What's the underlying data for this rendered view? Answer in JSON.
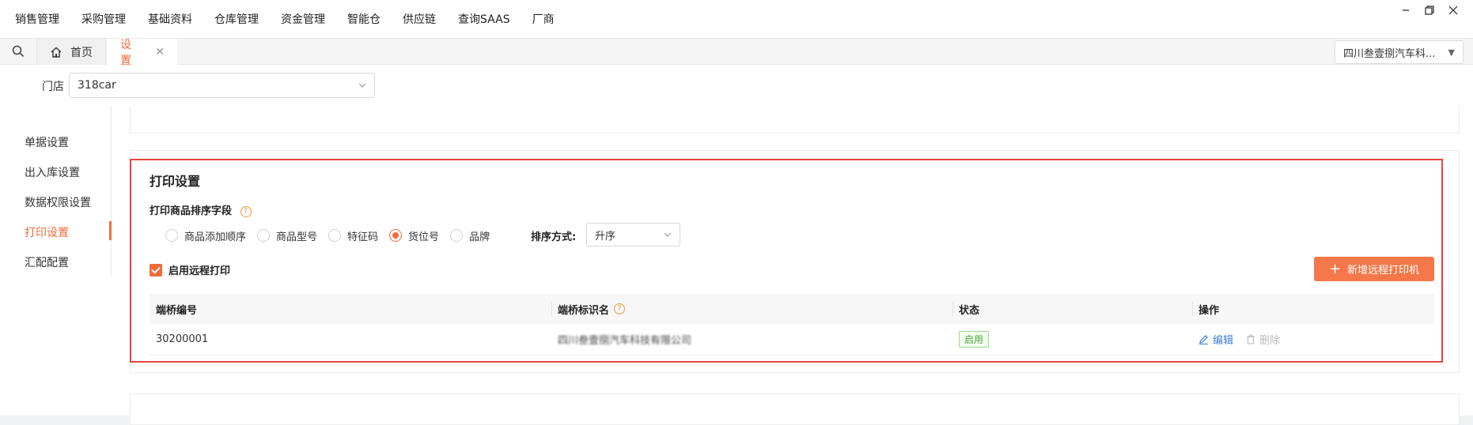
{
  "topmenu": {
    "items": [
      "销售管理",
      "采购管理",
      "基础资料",
      "仓库管理",
      "资金管理",
      "智能仓",
      "供应链",
      "查询SAAS",
      "厂商"
    ]
  },
  "tabs": {
    "home_label": "首页",
    "active_label": "设置",
    "company": "四川叁壹捌汽车科..."
  },
  "filter": {
    "store_label": "门店",
    "store_value": "318car"
  },
  "sidebar": {
    "items": [
      "单据设置",
      "出入库设置",
      "数据权限设置",
      "打印设置",
      "汇配配置"
    ],
    "active_index": 3
  },
  "print": {
    "title": "打印设置",
    "sort_field_label": "打印商品排序字段",
    "sort_options": [
      "商品添加顺序",
      "商品型号",
      "特征码",
      "货位号",
      "品牌"
    ],
    "selected_option": "货位号",
    "sort_method_label": "排序方式:",
    "sort_method_value": "升序",
    "remote_print_label": "启用远程打印",
    "remote_print_enabled": true,
    "add_button": "新增远程打印机",
    "table": {
      "headers": [
        "端桥编号",
        "端桥标识名",
        "状态",
        "操作"
      ],
      "rows": [
        {
          "id": "30200001",
          "name": "四川叁壹捌汽车科技有限公司",
          "status": "启用",
          "edit": "编辑",
          "delete": "删除"
        }
      ]
    }
  },
  "colors": {
    "accent": "#f26b3a",
    "highlight_border": "#e8433f",
    "link": "#3b7bdd",
    "success": "#52a838"
  }
}
